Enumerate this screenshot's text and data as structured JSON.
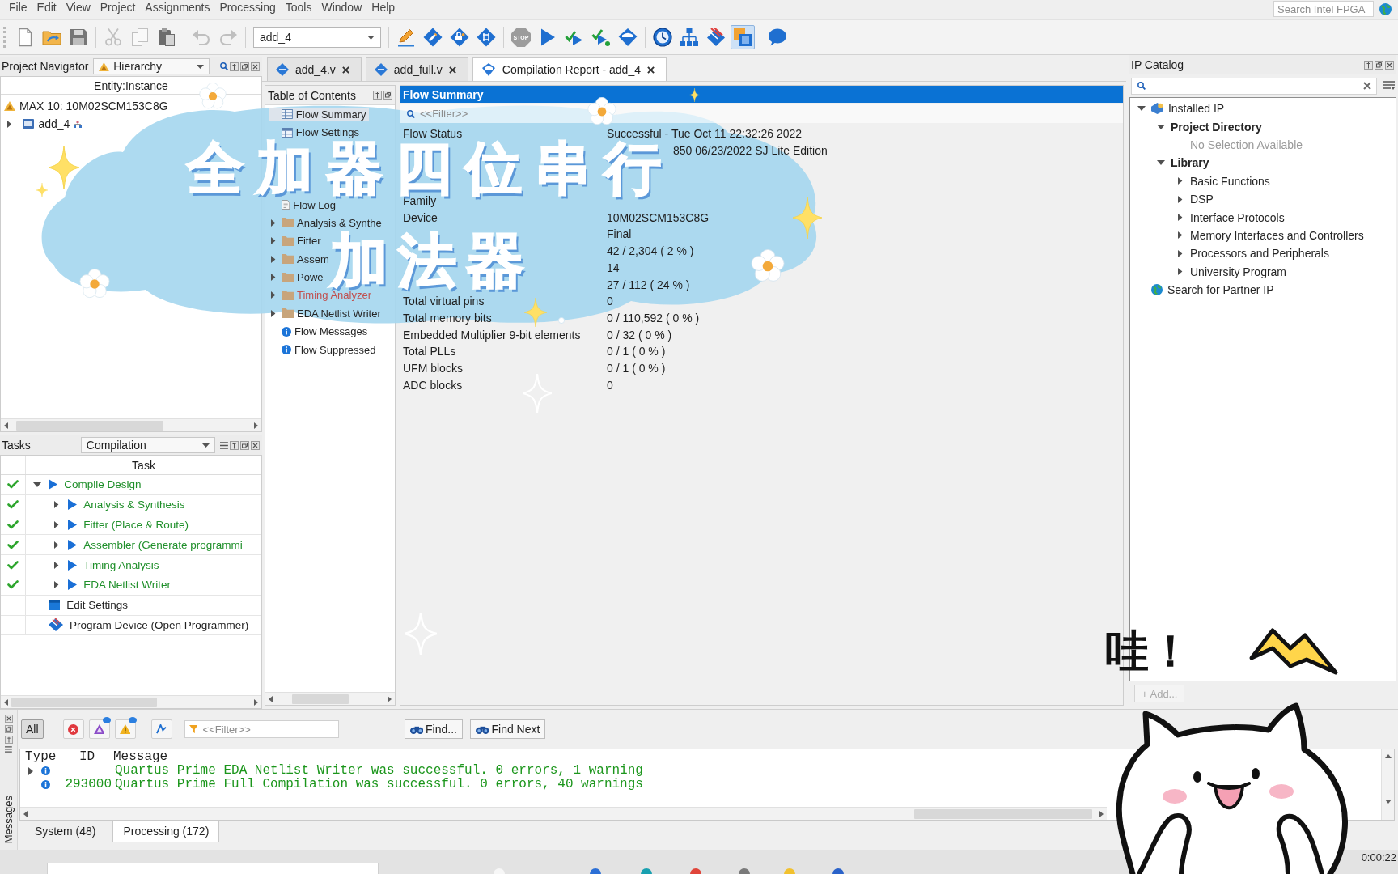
{
  "menu": [
    "File",
    "Edit",
    "View",
    "Project",
    "Assignments",
    "Processing",
    "Tools",
    "Window",
    "Help"
  ],
  "search": {
    "placeholder": "Search Intel FPGA"
  },
  "toolbar": {
    "project": "add_4",
    "buttons": [
      {
        "pressed": false,
        "disabled": false
      },
      {
        "pressed": false,
        "disabled": false
      },
      {
        "pressed": false,
        "disabled": false
      },
      {
        "pressed": false,
        "disabled": true
      },
      {
        "pressed": false,
        "disabled": true
      },
      {
        "pressed": false,
        "disabled": false
      },
      {
        "pressed": false,
        "disabled": true
      },
      {
        "pressed": false,
        "disabled": true
      },
      {
        "pressed": false,
        "disabled": false
      },
      {
        "pressed": false,
        "disabled": false
      },
      {
        "pressed": false,
        "disabled": false
      },
      {
        "pressed": false,
        "disabled": false
      },
      {
        "label": "STOP",
        "pressed": false,
        "disabled": true
      },
      {
        "pressed": false,
        "disabled": false
      },
      {
        "pressed": false,
        "disabled": false
      },
      {
        "pressed": false,
        "disabled": false
      },
      {
        "pressed": false,
        "disabled": false
      },
      {
        "pressed": false,
        "disabled": false
      },
      {
        "pressed": false,
        "disabled": false
      },
      {
        "pressed": false,
        "disabled": false
      },
      {
        "pressed": true,
        "disabled": false
      },
      {
        "pressed": false,
        "disabled": false
      }
    ]
  },
  "project_navigator": {
    "title": "Project Navigator",
    "view": "Hierarchy",
    "column": "Entity:Instance",
    "tree": [
      {
        "label": "MAX 10: 10M02SCM153C8G",
        "kind": "device"
      },
      {
        "label": "add_4",
        "kind": "entity",
        "expanded": false
      }
    ]
  },
  "tasks": {
    "title": "Tasks",
    "flow": "Compilation",
    "column": "Task",
    "items": [
      {
        "label": "Compile Design",
        "kind": "flow",
        "done": true,
        "expanded": true,
        "children": [
          {
            "label": "Analysis & Synthesis",
            "kind": "flow",
            "done": true,
            "expanded": false
          },
          {
            "label": "Fitter (Place & Route)",
            "kind": "flow",
            "done": true,
            "expanded": false
          },
          {
            "label": "Assembler (Generate programmi",
            "kind": "flow",
            "done": true,
            "expanded": false
          },
          {
            "label": "Timing Analysis",
            "kind": "flow",
            "done": true,
            "expanded": false
          },
          {
            "label": "EDA Netlist Writer",
            "kind": "flow",
            "done": true,
            "expanded": false
          }
        ]
      },
      {
        "label": "Edit Settings",
        "kind": "settings",
        "done": false
      },
      {
        "label": "Program Device (Open Programmer)",
        "kind": "programmer",
        "done": false
      }
    ]
  },
  "editor_tabs": [
    {
      "label": "add_4.v",
      "kind": "file",
      "selected": false
    },
    {
      "label": "add_full.v",
      "kind": "file",
      "selected": false
    },
    {
      "label": "Compilation Report - add_4",
      "kind": "report",
      "selected": true
    }
  ],
  "toc": {
    "title": "Table of Contents",
    "items": [
      {
        "label": "Flow Summary",
        "kind": "table",
        "selected": true,
        "failed": false
      },
      {
        "label": "Flow Settings",
        "kind": "settings",
        "selected": false,
        "failed": false
      },
      {
        "kind": "covered"
      },
      {
        "kind": "covered"
      },
      {
        "kind": "covered"
      },
      {
        "label": "Flow Log",
        "kind": "log",
        "selected": false,
        "failed": false
      },
      {
        "label": "Analysis & Synthe",
        "kind": "folder",
        "expanded": false,
        "selected": false,
        "failed": false
      },
      {
        "label": "Fitter",
        "kind": "folder",
        "expanded": false,
        "selected": false,
        "failed": false
      },
      {
        "label": "Assem",
        "kind": "folder",
        "expanded": false,
        "selected": false,
        "failed": false
      },
      {
        "label": "Powe",
        "kind": "folder",
        "expanded": false,
        "selected": false,
        "failed": false
      },
      {
        "label": "Timing Analyzer",
        "kind": "folder",
        "expanded": false,
        "selected": false,
        "failed": true
      },
      {
        "label": "EDA Netlist Writer",
        "kind": "folder",
        "expanded": false,
        "selected": false,
        "failed": false
      },
      {
        "label": "Flow Messages",
        "kind": "info",
        "selected": false,
        "failed": false
      },
      {
        "label": "Flow Suppressed",
        "kind": "info",
        "selected": false,
        "failed": false
      }
    ]
  },
  "flow_summary": {
    "title": "Flow Summary",
    "filter_placeholder": "<<Filter>>",
    "rows": [
      {
        "kind": "field",
        "label": "Flow Status",
        "value": "Successful - Tue Oct 11 22:32:26 2022"
      },
      {
        "kind": "tail",
        "value": "850 06/23/2022 SJ Lite Edition"
      },
      {
        "kind": "covered"
      },
      {
        "kind": "covered"
      },
      {
        "kind": "field",
        "label": "Family"
      },
      {
        "kind": "field",
        "label": "Device",
        "value": "10M02SCM153C8G"
      },
      {
        "kind": "field",
        "value": "Final"
      },
      {
        "kind": "field",
        "value": "42 / 2,304 ( 2 % )"
      },
      {
        "kind": "field",
        "value": "14"
      },
      {
        "kind": "field",
        "value": "27 / 112 ( 24 % )"
      },
      {
        "kind": "field",
        "label": "Total virtual pins",
        "value": "0"
      },
      {
        "kind": "field",
        "label": "Total memory bits",
        "value": "0 / 110,592 ( 0 % )"
      },
      {
        "kind": "field",
        "label": "Embedded Multiplier 9-bit elements",
        "value": "0 / 32 ( 0 % )"
      },
      {
        "kind": "field",
        "label": "Total PLLs",
        "value": "0 / 1 ( 0 % )"
      },
      {
        "kind": "field",
        "label": "UFM blocks",
        "value": "0 / 1 ( 0 % )"
      },
      {
        "kind": "field",
        "label": "ADC blocks",
        "value": "0"
      }
    ]
  },
  "ip_catalog": {
    "title": "IP Catalog",
    "tree": [
      {
        "label": "Installed IP",
        "kind": "installed",
        "expanded": true,
        "children": [
          {
            "label": "Project Directory",
            "kind": "group",
            "expanded": true,
            "children": [
              {
                "label": "No Selection Available",
                "kind": "empty"
              }
            ]
          },
          {
            "label": "Library",
            "kind": "group",
            "expanded": true,
            "children": [
              {
                "label": "Basic Functions",
                "kind": "category",
                "expanded": false
              },
              {
                "label": "DSP",
                "kind": "category",
                "expanded": false
              },
              {
                "label": "Interface Protocols",
                "kind": "category",
                "expanded": false
              },
              {
                "label": "Memory Interfaces and Controllers",
                "kind": "category",
                "expanded": false
              },
              {
                "label": "Processors and Peripherals",
                "kind": "category",
                "expanded": false
              },
              {
                "label": "University Program",
                "kind": "category",
                "expanded": false
              }
            ]
          }
        ]
      },
      {
        "label": "Search for Partner IP",
        "kind": "partner"
      }
    ],
    "add_button": {
      "label": "+ Add...",
      "disabled": true
    }
  },
  "messages": {
    "panel_label": "Messages",
    "filters": [
      {
        "kind": "all",
        "label": "All",
        "selected": true,
        "flagged": false
      },
      {
        "kind": "error",
        "selected": false,
        "flagged": false
      },
      {
        "kind": "critical",
        "selected": false,
        "flagged": true
      },
      {
        "kind": "warning",
        "selected": false,
        "flagged": true
      },
      {
        "kind": "suppressed",
        "selected": false,
        "flagged": false
      }
    ],
    "filter_placeholder": "<<Filter>>",
    "find": "Find...",
    "find_next": "Find Next",
    "columns": [
      "Type",
      "ID",
      "Message"
    ],
    "rows": [
      {
        "kind": "info",
        "expandable": true,
        "expanded": false,
        "text": "Quartus Prime EDA Netlist Writer was successful. 0 errors, 1 warning"
      },
      {
        "kind": "info",
        "expandable": false,
        "id": "293000",
        "text": "Quartus Prime Full Compilation was successful. 0 errors, 40 warnings"
      }
    ],
    "tabs": [
      {
        "label": "System (48)",
        "selected": false
      },
      {
        "label": "Processing (172)",
        "selected": true
      }
    ]
  },
  "overlay": {
    "title_lines": [
      "全加器四位串行",
      "加法器"
    ],
    "exclamation": "哇！"
  },
  "timestamp": "0:00:22"
}
